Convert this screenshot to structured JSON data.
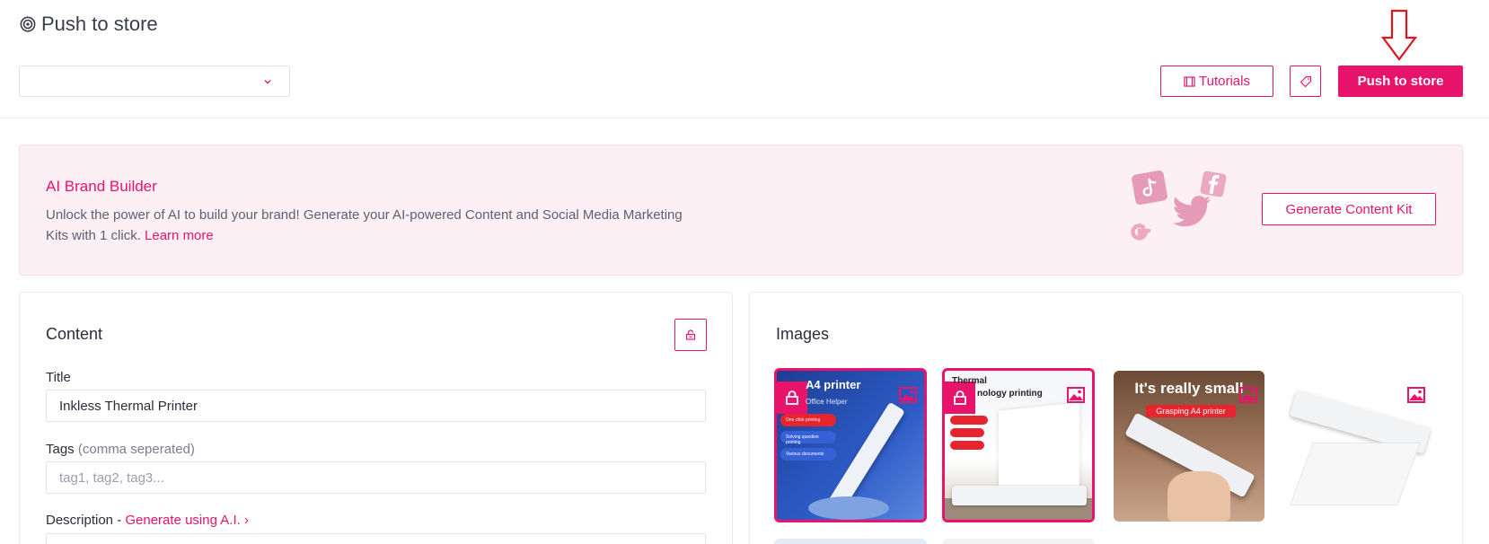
{
  "header": {
    "title": "Push to store",
    "store_select_value": "",
    "tutorials_label": "Tutorials",
    "push_label": "Push to store"
  },
  "banner": {
    "title": "AI Brand Builder",
    "text": "Unlock the power of AI to build your brand! Generate your AI-powered Content and Social Media Marketing Kits with 1 click.",
    "link": "Learn more",
    "generate_label": "Generate Content Kit"
  },
  "content": {
    "title": "Content",
    "title_label": "Title",
    "title_value": "Inkless Thermal Printer",
    "tags_label": "Tags",
    "tags_hint": "(comma seperated)",
    "tags_placeholder": "tag1, tag2, tag3...",
    "description_label": "Description - ",
    "description_generate": "Generate using A.I. ›"
  },
  "images": {
    "title": "Images",
    "thumbs": [
      {
        "heading": "A4 printer",
        "sub": "Office Helper",
        "pills": [
          "One click printing",
          "Solving question printing",
          "Various documents"
        ]
      },
      {
        "heading": "Thermal",
        "heading2": "nology printing",
        "sub": "",
        "pills": [
          "",
          "",
          ""
        ]
      },
      {
        "heading": "It's really small",
        "sub": "Grasping A4 printer"
      },
      {
        "heading": ""
      }
    ]
  },
  "colors": {
    "accent": "#e8146b",
    "banner_bg": "#fdf0f4"
  }
}
